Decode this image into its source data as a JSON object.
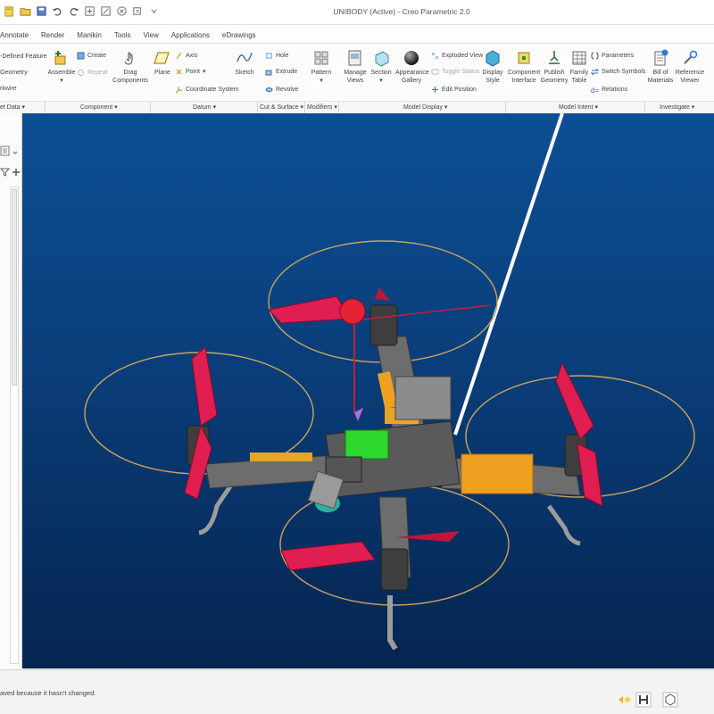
{
  "window": {
    "title": "UNIBODY (Active) - Creo Parametric 2.0"
  },
  "quick_access": {
    "icons": [
      "new-file-icon",
      "open-icon",
      "save-icon",
      "undo-icon",
      "redo-icon",
      "regenerate-icon",
      "window-icon",
      "close-icon",
      "customize-icon"
    ]
  },
  "tabs": [
    "Annotate",
    "Render",
    "Manikin",
    "Tools",
    "View",
    "Applications",
    "eDrawings"
  ],
  "ribbon": {
    "get_data": {
      "items": [
        "-Defined Feature",
        "Geometry",
        "rkwire"
      ],
      "group": "et Data"
    },
    "component": {
      "assemble": "Assemble",
      "create": "Create",
      "repeat": "Repeat",
      "drag": [
        "Drag",
        "Components"
      ],
      "group": "Component"
    },
    "datum": {
      "plane": "Plane",
      "axis": "Axis",
      "point": "Point",
      "coord": "Coordinate System",
      "sketch": "Sketch",
      "group": "Datum"
    },
    "cut_surface": {
      "hole": "Hole",
      "extrude": "Extrude",
      "revolve": "Revolve",
      "group": "Cut & Surface"
    },
    "modifiers": {
      "pattern": "Pattern",
      "group": "Modifiers"
    },
    "model_display": {
      "manage_views": [
        "Manage",
        "Views"
      ],
      "section": "Section",
      "appearance": [
        "Appearance",
        "Gallery"
      ],
      "exploded": "Exploded View",
      "toggle_status": "Toggle Status",
      "edit_position": "Edit Position",
      "display_style": [
        "Display",
        "Style"
      ],
      "group": "Model Display"
    },
    "model_intent": {
      "component_interface": [
        "Component",
        "Interface"
      ],
      "publish_geometry": [
        "Publish",
        "Geometry"
      ],
      "family_table": [
        "Family",
        "Table"
      ],
      "parameters": "Parameters",
      "switch_symbols": "Switch Symbols",
      "relations": "Relations",
      "group": "Model Intent"
    },
    "investigate": {
      "bom": [
        "Bill of",
        "Materials"
      ],
      "reference_viewer": [
        "Reference",
        "Viewer"
      ],
      "group": "Investigate"
    }
  },
  "left_panel": {
    "icons": [
      "tree-icon",
      "filter-icon",
      "add-icon"
    ]
  },
  "viewport": {
    "background_top": "#0c4f94",
    "background_bottom": "#052550",
    "model": "quadcopter-drone"
  },
  "status_bar": {
    "message": "aved because it hasn't changed.",
    "icons": [
      "selection-filter-icon",
      "binoculars-icon",
      "model-cube-icon"
    ]
  },
  "colors": {
    "propeller": "#e01e52",
    "frame": "#707070",
    "accent": "#f0a020",
    "pcb": "#2bd82b",
    "prop_circle": "#c8a55a"
  }
}
